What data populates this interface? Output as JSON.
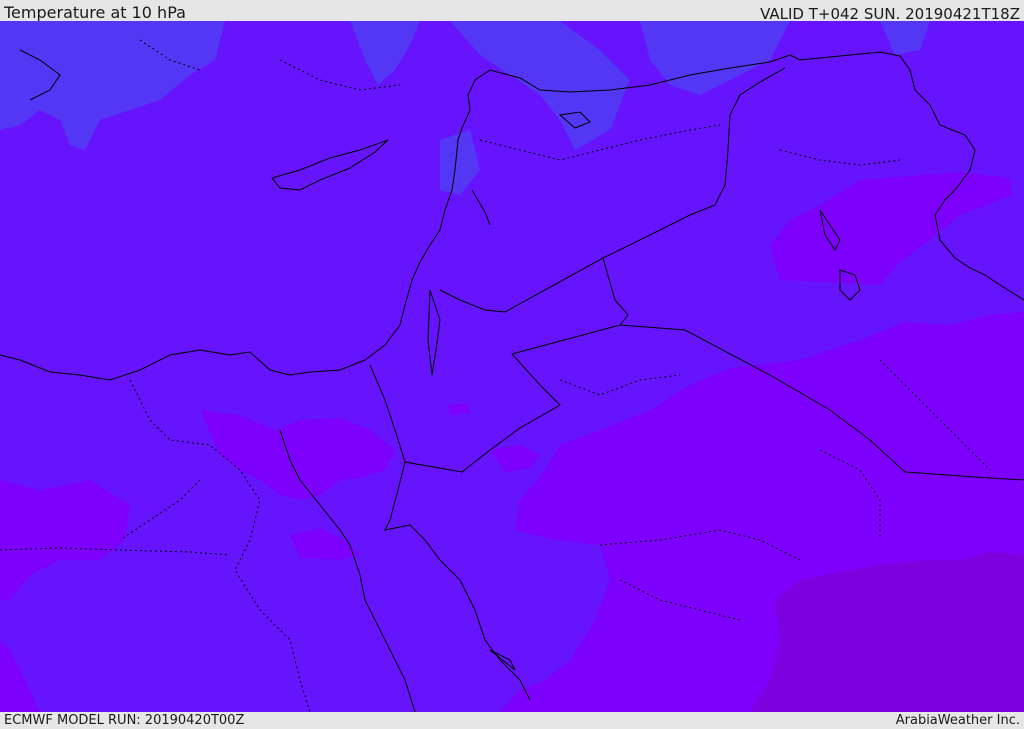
{
  "header": {
    "title": "Temperature at 10 hPa",
    "valid": "VALID T+042 SUN. 20190421T18Z"
  },
  "footer": {
    "model_run": "ECMWF MODEL RUN: 20190420T00Z",
    "credit": "ArabiaWeather Inc."
  },
  "colors": {
    "level_cold": "#5337f4",
    "level_base": "#6614fb",
    "level_warm": "#7c00fc",
    "level_warmest": "#7d00df",
    "border": "#000000"
  }
}
